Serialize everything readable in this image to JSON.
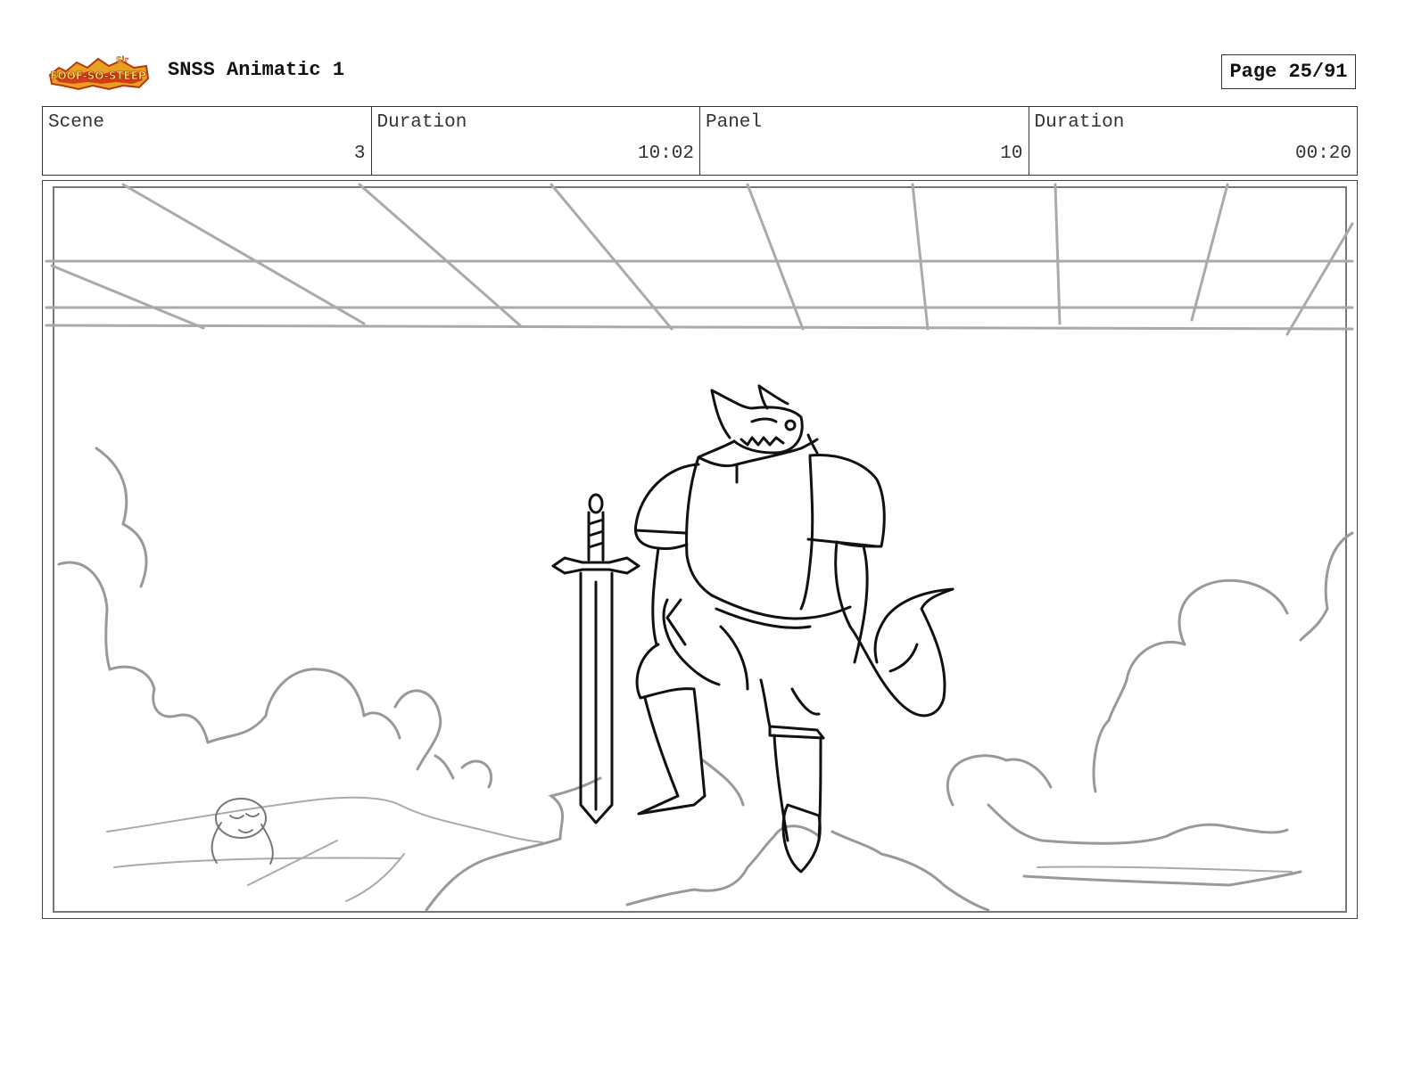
{
  "header": {
    "logo_text": "Sir Foof-So-Steep",
    "title": "SNSS Animatic 1",
    "page_label": "Page 25/91"
  },
  "info": [
    {
      "label": "Scene",
      "value": "3"
    },
    {
      "label": "Duration",
      "value": "10:02"
    },
    {
      "label": "Panel",
      "value": "10"
    },
    {
      "label": "Duration",
      "value": "00:20"
    }
  ],
  "panel": {
    "description_icons": [
      "wolf-knight-sketch",
      "sword-sketch",
      "cloud-sketch",
      "ceiling-grid-sketch",
      "small-creature-sketch"
    ]
  }
}
